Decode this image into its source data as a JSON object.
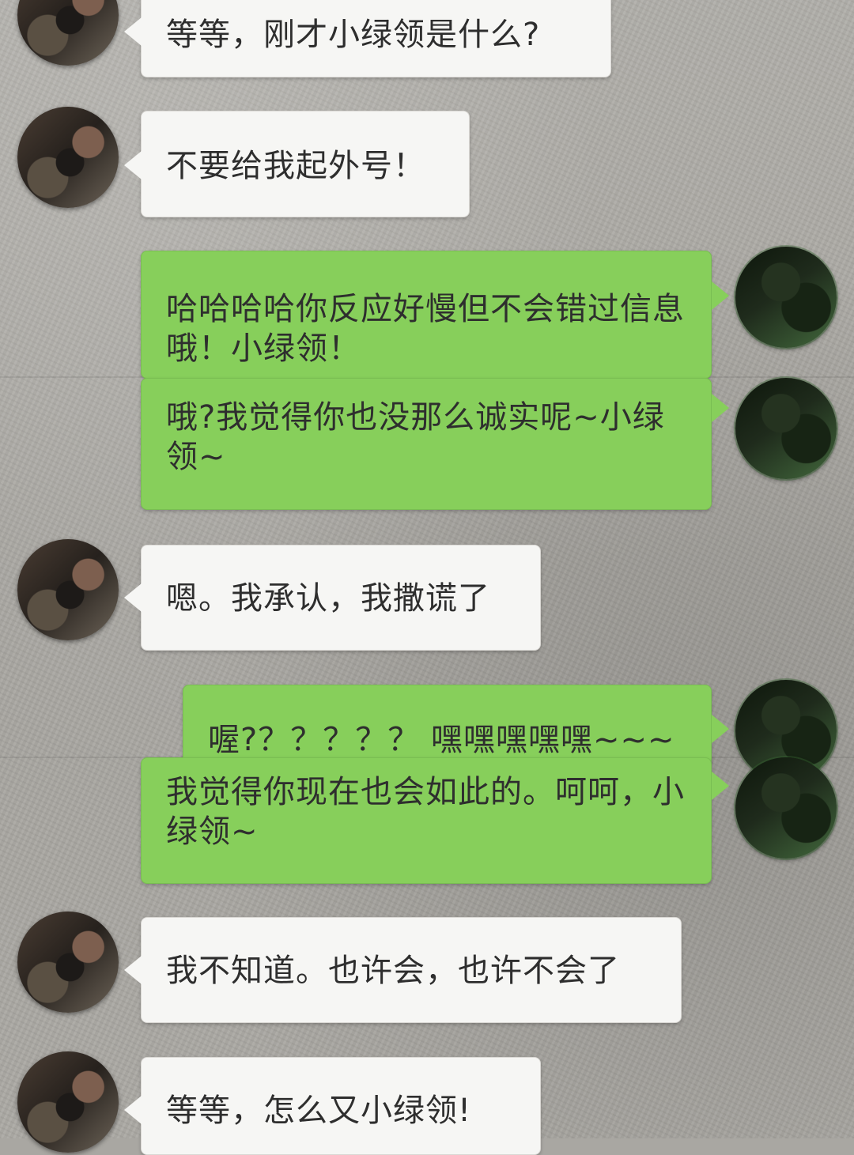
{
  "conversation": {
    "messages": [
      {
        "sender": "other",
        "text": "等等，刚才小绿领是什么?"
      },
      {
        "sender": "other",
        "text": "不要给我起外号！"
      },
      {
        "sender": "me",
        "text": "哈哈哈哈你反应好慢但不会错过信息哦！小绿领！"
      },
      {
        "sender": "me",
        "text": "哦?我觉得你也没那么诚实呢~小绿领~"
      },
      {
        "sender": "other",
        "text": "嗯。我承认，我撒谎了"
      },
      {
        "sender": "me",
        "text": "喔?？？？？？ 嘿嘿嘿嘿嘿~~~"
      },
      {
        "sender": "me",
        "text": "我觉得你现在也会如此的。呵呵，小绿领~"
      },
      {
        "sender": "other",
        "text": "我不知道。也许会，也许不会了"
      },
      {
        "sender": "other",
        "text": "等等，怎么又小绿领!"
      }
    ]
  },
  "theme": {
    "received_bubble": "#f6f6f4",
    "sent_bubble": "#87cf5b",
    "background": "#a9a7a2",
    "text": "#2e2e2e"
  },
  "icons": {
    "received_avatar": "avatar-man-portrait",
    "sent_avatar": "avatar-dark-green-portrait"
  }
}
